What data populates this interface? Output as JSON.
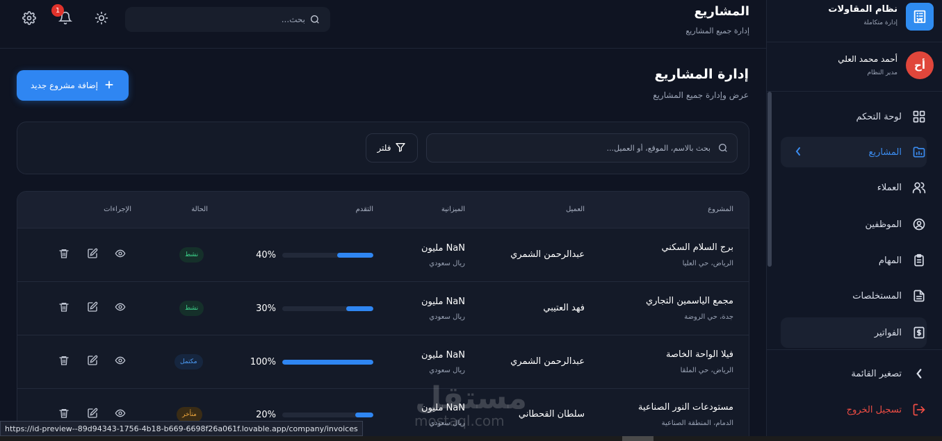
{
  "app": {
    "title": "نظام المقاولات",
    "subtitle": "إدارة متكاملة"
  },
  "user": {
    "initials": "أح",
    "name": "أحمد محمد العلي",
    "role": "مدير النظام"
  },
  "sidebar": {
    "items": [
      {
        "label": "لوحة التحكم",
        "icon": "dashboard-grid-icon"
      },
      {
        "label": "المشاريع",
        "icon": "folder-chart-icon",
        "active": true
      },
      {
        "label": "العملاء",
        "icon": "users-icon"
      },
      {
        "label": "الموظفين",
        "icon": "user-circle-icon"
      },
      {
        "label": "المهام",
        "icon": "clipboard-icon"
      },
      {
        "label": "المستخلصات",
        "icon": "document-icon"
      },
      {
        "label": "الفواتير",
        "icon": "receipt-dollar-icon"
      }
    ],
    "collapse_label": "تصغير القائمة",
    "logout_label": "تسجيل الخروج"
  },
  "header": {
    "title": "المشاريع",
    "subtitle": "إدارة جميع المشاريع",
    "search_placeholder": "بحث...",
    "notification_count": "1"
  },
  "page": {
    "title": "إدارة المشاريع",
    "subtitle": "عرض وإدارة جميع المشاريع",
    "add_button": "إضافة مشروع جديد"
  },
  "filters": {
    "search_placeholder": "بحث بالاسم، الموقع، أو العميل...",
    "filter_button": "فلتر"
  },
  "table": {
    "columns": {
      "project": "المشروع",
      "client": "العميل",
      "budget": "الميزانية",
      "progress": "التقدم",
      "status": "الحالة",
      "actions": "الإجراءات"
    },
    "rows": [
      {
        "name": "برج السلام السكني",
        "location": "الرياض، حي العليا",
        "client": "عبدالرحمن الشمري",
        "budget": "NaN مليون",
        "currency": "ريال سعودي",
        "progress": 40,
        "progress_label": "40%",
        "status": "نشط",
        "status_type": "active"
      },
      {
        "name": "مجمع الياسمين التجاري",
        "location": "جدة، حي الروضة",
        "client": "فهد العتيبي",
        "budget": "NaN مليون",
        "currency": "ريال سعودي",
        "progress": 30,
        "progress_label": "30%",
        "status": "نشط",
        "status_type": "active"
      },
      {
        "name": "فيلا الواحة الخاصة",
        "location": "الرياض، حي الملقا",
        "client": "عبدالرحمن الشمري",
        "budget": "NaN مليون",
        "currency": "ريال سعودي",
        "progress": 100,
        "progress_label": "100%",
        "status": "مكتمل",
        "status_type": "done"
      },
      {
        "name": "مستودعات النور الصناعية",
        "location": "الدمام، المنطقة الصناعية",
        "client": "سلطان القحطاني",
        "budget": "NaN مليون",
        "currency": "ريال سعودي",
        "progress": 20,
        "progress_label": "20%",
        "status": "متأخر",
        "status_type": "late"
      }
    ]
  },
  "status_bar": {
    "url": "https://id-preview--89d94343-1756-4b18-b669-6698f26a061f.lovable.app/company/invoices"
  },
  "watermark": {
    "main": "مستقل",
    "sub": "mostaql.com"
  },
  "colors": {
    "accent": "#2f86f2",
    "active_status": "#3dd68c",
    "done_status": "#4d9cf5",
    "late_status": "#f0a83d",
    "danger": "#ef4d44"
  }
}
